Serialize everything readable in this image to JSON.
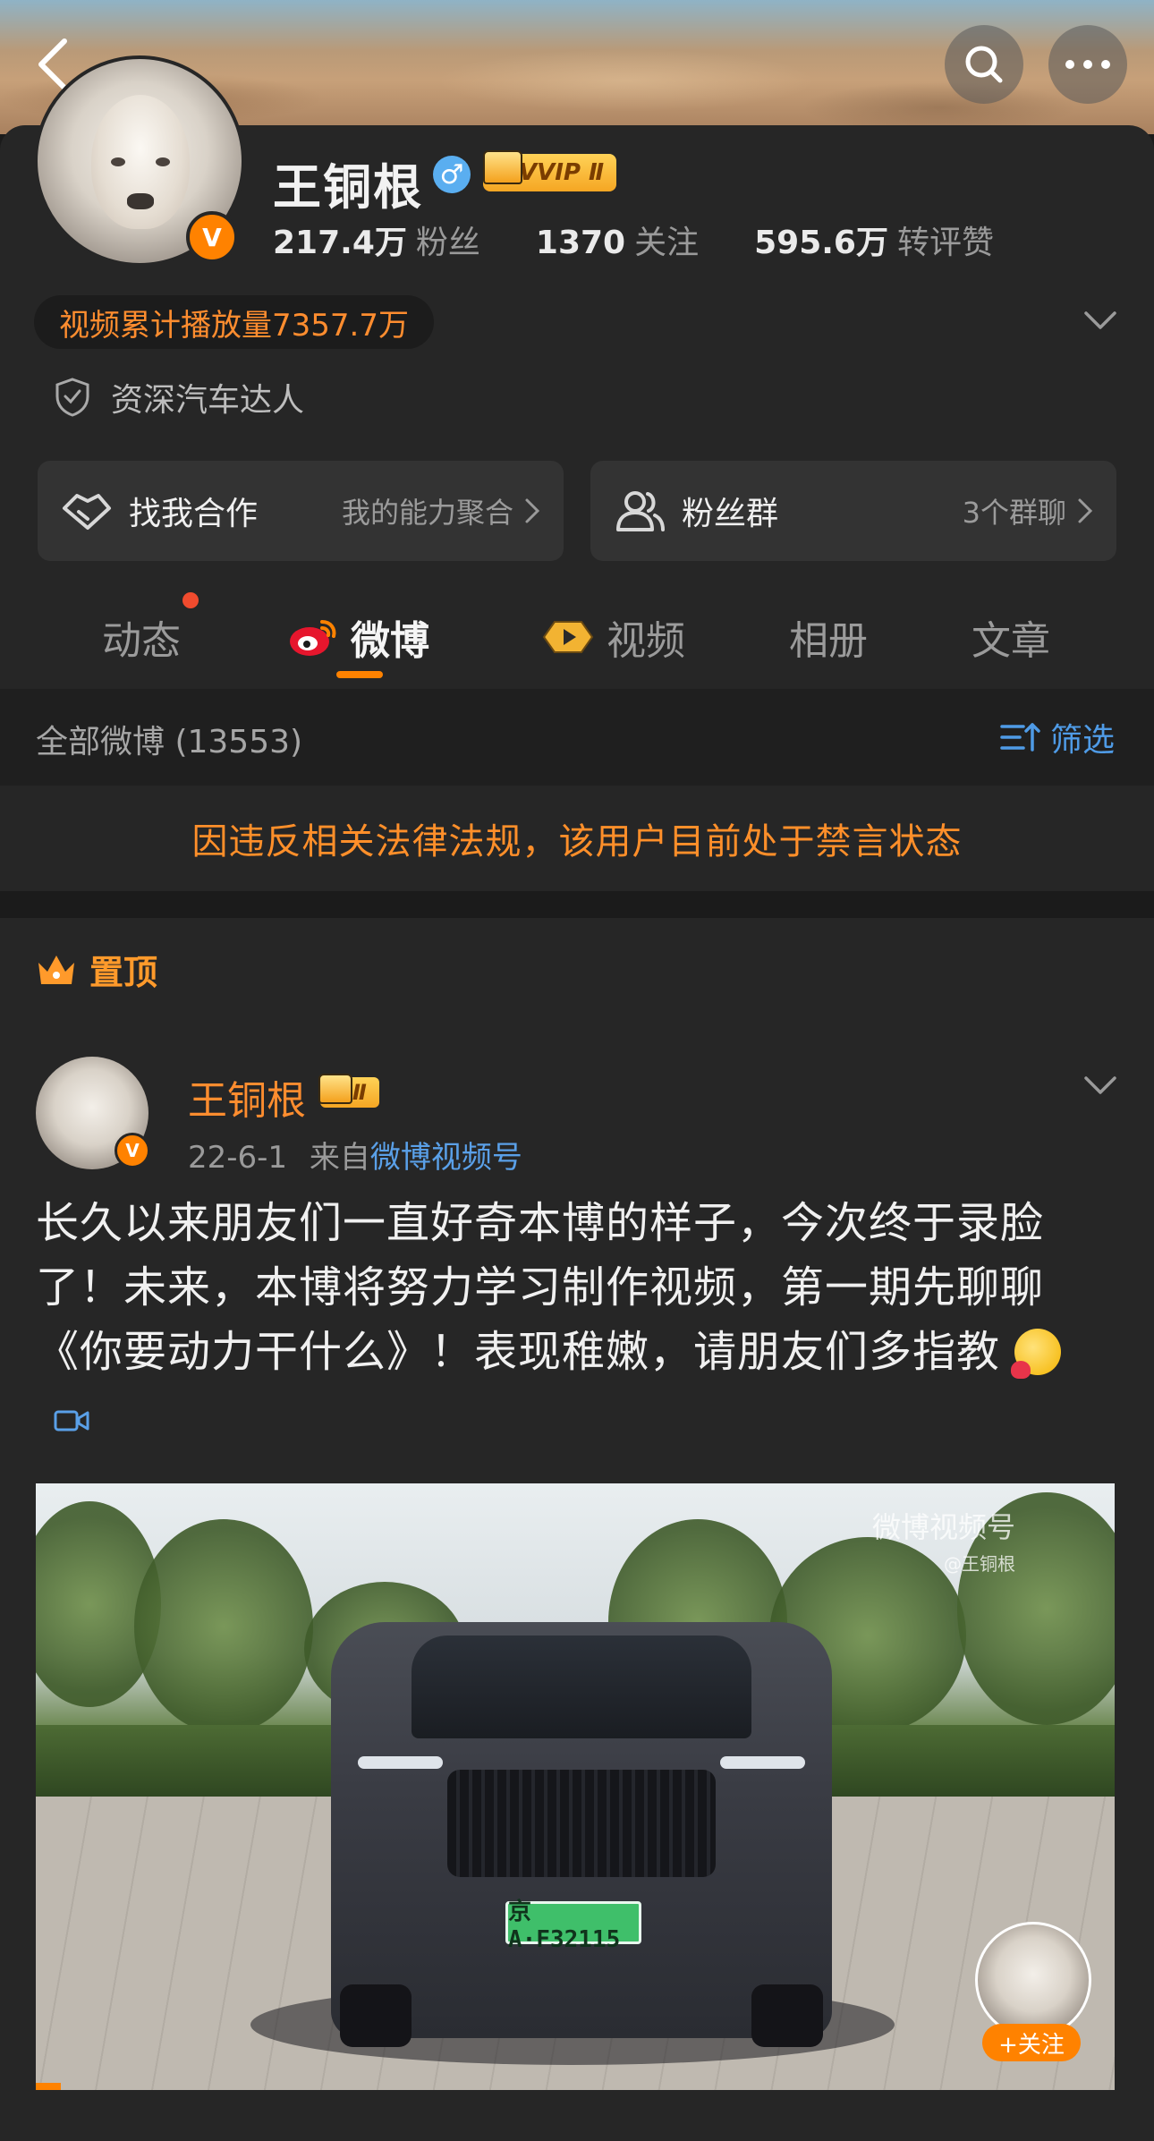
{
  "profile": {
    "name": "王铜根",
    "vip_label": "VVIP Ⅱ",
    "followers_value": "217.4万",
    "followers_label": "粉丝",
    "following_value": "1370",
    "following_label": "关注",
    "likes_value": "595.6万",
    "likes_label": "转评赞",
    "video_plays": "视频累计播放量7357.7万",
    "tag": "资深汽车达人"
  },
  "actions": {
    "cooperate_label": "找我合作",
    "cooperate_sub": "我的能力聚合",
    "fans_group_label": "粉丝群",
    "fans_group_sub": "3个群聊"
  },
  "tabs": [
    {
      "label": "动态"
    },
    {
      "label": "微博"
    },
    {
      "label": "视频"
    },
    {
      "label": "相册"
    },
    {
      "label": "文章"
    }
  ],
  "filter": {
    "count_label": "全部微博 (13553)",
    "filter_label": "筛选"
  },
  "banned_notice": "因违反相关法律法规，该用户目前处于禁言状态",
  "post": {
    "pinned_label": "置顶",
    "author": "王铜根",
    "vip_label": "Ⅱ",
    "date": "22-6-1",
    "from_prefix": "来自",
    "source": "微博视频号",
    "text": "长久以来朋友们一直好奇本博的样子，今次终于录脸了！未来，本博将努力学习制作视频，第一期先聊聊《你要动力干什么》！表现稚嫩，请朋友们多指教",
    "video": {
      "watermark": "微博视频号",
      "watermark_handle": "@王铜根",
      "plate": "京A·F32115",
      "follow_label": "+关注"
    }
  },
  "colors": {
    "accent": "#ff8200",
    "link": "#4f9be6",
    "background": "#262626"
  }
}
